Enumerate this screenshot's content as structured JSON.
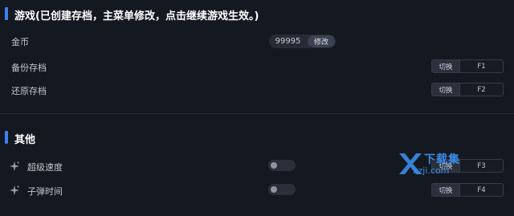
{
  "section_game": {
    "title": "游戏(已创建存档，主菜单修改，点击继续游戏生效。)",
    "items": [
      {
        "label": "金币",
        "value": "99995",
        "edit_label": "修改"
      },
      {
        "label": "备份存档",
        "toggle_label": "切换",
        "key": "F1"
      },
      {
        "label": "还原存档",
        "toggle_label": "切换",
        "key": "F2"
      }
    ]
  },
  "section_other": {
    "title": "其他",
    "items": [
      {
        "label": "超级速度",
        "icon": "sparkle-icon",
        "enabled": false,
        "toggle_label": "切换",
        "key": "F3"
      },
      {
        "label": "子弹时间",
        "icon": "sparkle-icon",
        "enabled": false,
        "toggle_label": "切换",
        "key": "F4"
      }
    ]
  },
  "watermark": {
    "title": "下载集",
    "url": "xzji.com"
  },
  "colors": {
    "accent": "#3f7ff0",
    "background": "#141820",
    "watermark": "#3b8de8"
  }
}
